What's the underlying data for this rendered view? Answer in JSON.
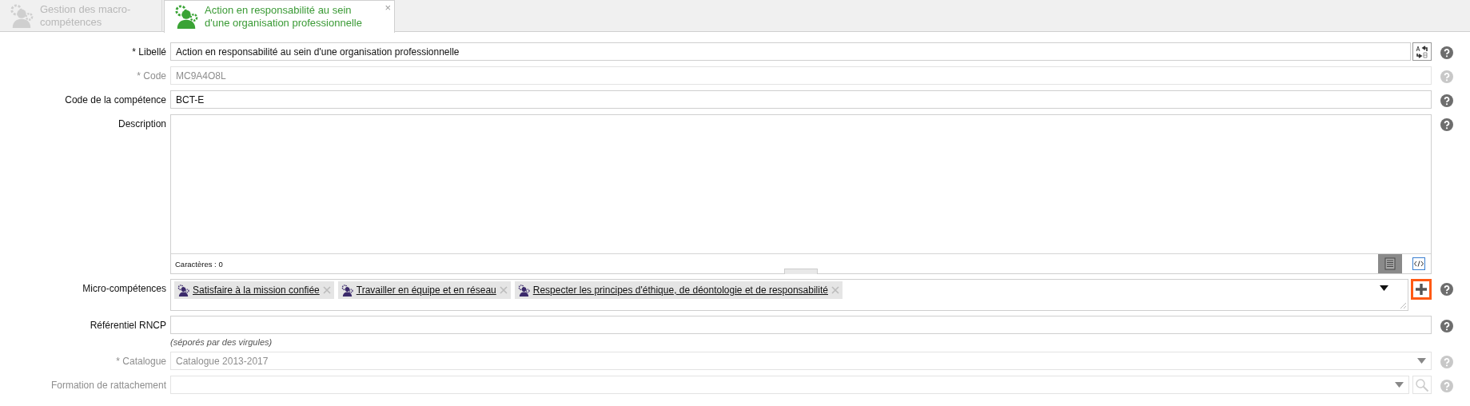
{
  "tabs": [
    {
      "label": "Gestion des macro-compétences",
      "selected": false
    },
    {
      "label": "Action en responsabilité au sein d'une organisation professionnelle",
      "selected": true,
      "close": "×"
    }
  ],
  "form": {
    "fields": [
      {
        "kind": "text",
        "label": "* Libellé",
        "value": "Action en responsabilité au sein d'une organisation professionnelle",
        "disabled": false,
        "translate": true
      },
      {
        "kind": "text",
        "label": "* Code",
        "value": "MC9A4O8L",
        "disabled": true
      },
      {
        "kind": "text",
        "label": "Code de la compétence",
        "value": "BCT-E",
        "disabled": false
      },
      {
        "kind": "richtext",
        "label": "Description",
        "char_count": "Caractères : 0"
      },
      {
        "kind": "tags",
        "label": "Micro-compétences",
        "add_highlighted": true,
        "tags": [
          "Satisfaire à la mission confiée",
          "Travailler en équipe et en réseau",
          "Respecter les principes d'éthique, de déontologie et de responsabilité"
        ]
      },
      {
        "kind": "text",
        "label": "Référentiel RNCP",
        "hint": "(séporés par des virgules)",
        "disabled": false
      },
      {
        "kind": "select",
        "label": "* Catalogue",
        "value": "Catalogue 2013-2017",
        "disabled": true
      },
      {
        "kind": "select",
        "label": "Formation de rattachement",
        "disabled": true,
        "search": true
      }
    ]
  }
}
